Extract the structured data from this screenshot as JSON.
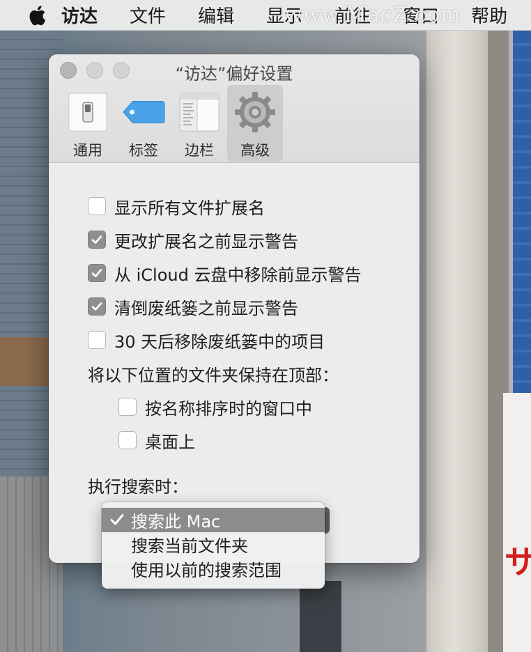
{
  "menubar": {
    "apple_icon": "apple-logo-icon",
    "items": [
      "访达",
      "文件",
      "编辑",
      "显示",
      "前往",
      "窗口",
      "帮助"
    ],
    "watermark": "www.MacZ.com"
  },
  "window": {
    "title": "“访达”偏好设置",
    "tabs": [
      {
        "label": "通用",
        "icon": "switch-icon"
      },
      {
        "label": "标签",
        "icon": "tag-icon"
      },
      {
        "label": "边栏",
        "icon": "sidebar-icon"
      },
      {
        "label": "高级",
        "icon": "gear-icon",
        "active": true
      }
    ]
  },
  "advanced": {
    "options": [
      {
        "label": "显示所有文件扩展名",
        "checked": false
      },
      {
        "label": "更改扩展名之前显示警告",
        "checked": true
      },
      {
        "label": "从 iCloud 云盘中移除前显示警告",
        "checked": true
      },
      {
        "label": "清倒废纸篓之前显示警告",
        "checked": true
      },
      {
        "label": "30 天后移除废纸篓中的项目",
        "checked": false
      }
    ],
    "folders_on_top_label": "将以下位置的文件夹保持在顶部：",
    "folders_on_top": [
      {
        "label": "按名称排序时的窗口中",
        "checked": false
      },
      {
        "label": "桌面上",
        "checked": false
      }
    ],
    "search_label": "执行搜索时：",
    "search_menu": {
      "selected_index": 0,
      "options": [
        "搜索此 Mac",
        "搜索当前文件夹",
        "使用以前的搜索范围"
      ]
    }
  },
  "desktop": {
    "sign_text": "サ"
  }
}
